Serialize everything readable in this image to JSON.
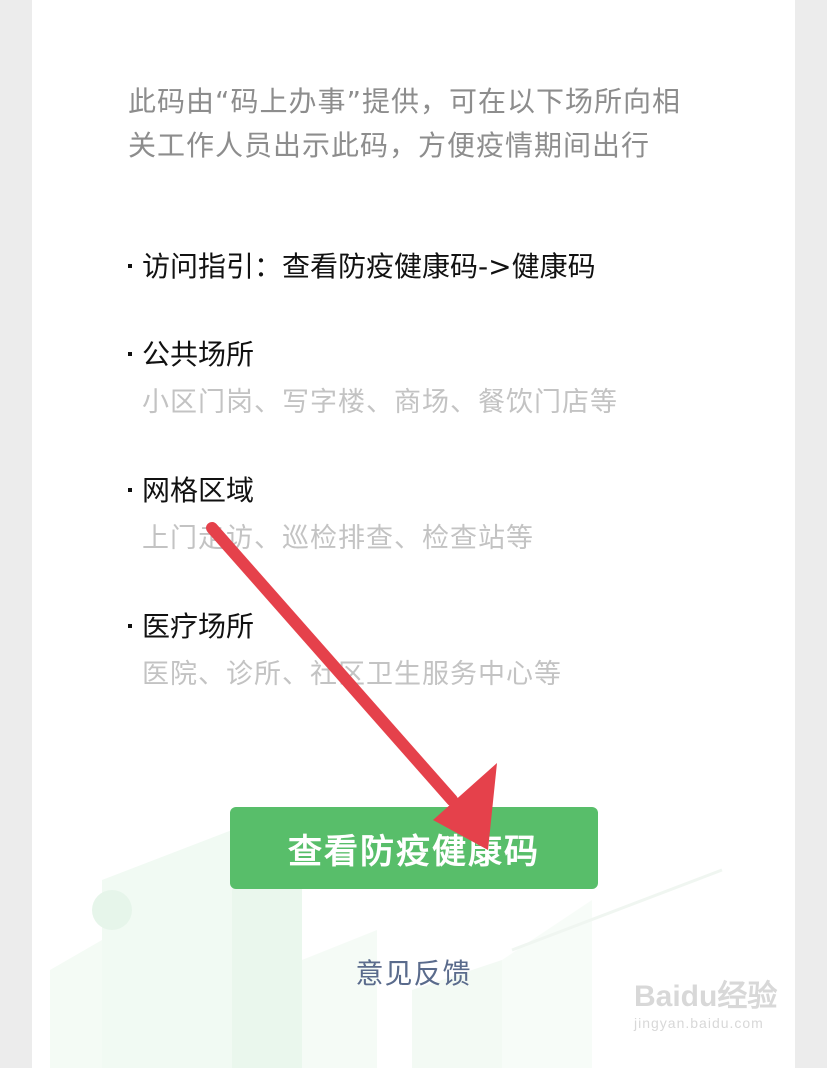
{
  "page": {
    "title_partial": "",
    "intro_text": "此码由“码上办事”提供，可在以下场所向相关工作人员出示此码，方便疫情期间出行",
    "items": [
      {
        "title": "访问指引：查看防疫健康码->健康码",
        "subtitle": ""
      },
      {
        "title": "公共场所",
        "subtitle": "小区门岗、写字楼、商场、餐饮门店等"
      },
      {
        "title": "网格区域",
        "subtitle": "上门走访、巡检排查、检查站等"
      },
      {
        "title": "医疗场所",
        "subtitle": "医院、诊所、社区卫生服务中心等"
      }
    ],
    "primary_button_label": "查看防疫健康码",
    "feedback_link": "意见反馈"
  },
  "watermark": {
    "brand": "Baidu经验",
    "url": "jingyan.baidu.com"
  },
  "colors": {
    "primary": "#58be6a",
    "link": "#5a6b8c",
    "annotation_arrow": "#e5414b"
  }
}
